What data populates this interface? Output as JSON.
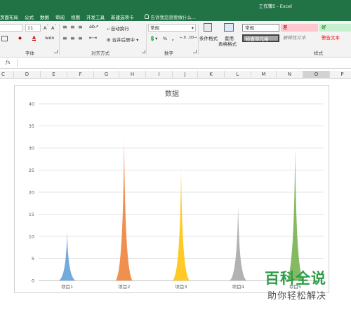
{
  "window": {
    "doc_title": "工作簿5 - Excel"
  },
  "tabs": [
    "页面布局",
    "公式",
    "数据",
    "审阅",
    "视图",
    "开发工具",
    "新建选项卡"
  ],
  "tell_me": "告诉我您想要做什么...",
  "ribbon": {
    "font_size": "11",
    "wrap_text": "自动换行",
    "merge_center": "合并后居中",
    "number_format": "常规",
    "percent": "%",
    "comma": ",",
    "conditional_format": "条件格式",
    "table_format_line1": "套用",
    "table_format_line2": "表格格式",
    "styles": {
      "normal": "常规",
      "bad": "差",
      "good": "好",
      "check_cell": "检查单元格",
      "explanatory": "解释性文本",
      "warning": "警告文本"
    },
    "groups": {
      "font": "字体",
      "alignment": "对齐方式",
      "number": "数字",
      "styles": "样式"
    }
  },
  "formula_bar": {
    "fx": "fx"
  },
  "columns": [
    "C",
    "D",
    "E",
    "F",
    "G",
    "H",
    "I",
    "J",
    "K",
    "L",
    "M",
    "N",
    "O",
    "P"
  ],
  "chart_data": {
    "type": "area",
    "title": "数据",
    "categories": [
      "项目1",
      "项目2",
      "项目3",
      "项目4",
      "项目5"
    ],
    "values": [
      11,
      32,
      25,
      17,
      30
    ],
    "colors": [
      "#5b9bd5",
      "#ed7d31",
      "#ffc000",
      "#a5a5a5",
      "#70ad47"
    ],
    "ylim": [
      0,
      40
    ],
    "yticks": [
      0,
      5,
      10,
      15,
      20,
      25,
      30,
      35,
      40
    ],
    "grid": true
  },
  "watermark": {
    "main": "百科全说",
    "sub": "助你轻松解决"
  }
}
